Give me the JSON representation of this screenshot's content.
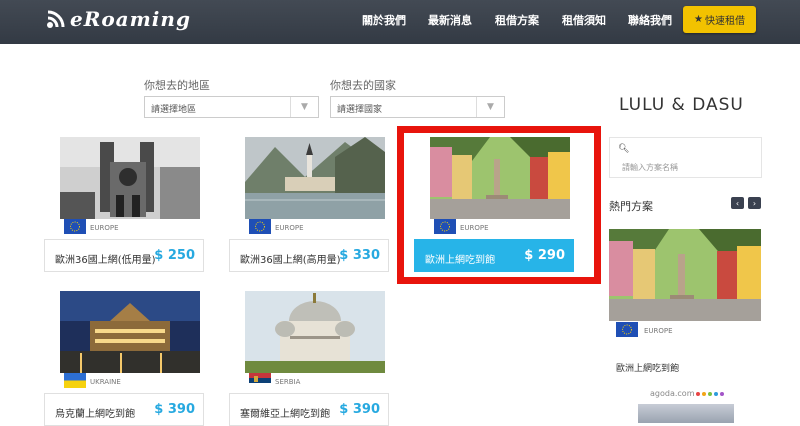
{
  "header": {
    "logo_text": "eRoaming",
    "nav": [
      "關於我們",
      "最新消息",
      "租借方案",
      "租借須知",
      "聯絡我們"
    ],
    "quick_rent": "快速租借"
  },
  "filters": {
    "region_label": "你想去的地區",
    "region_value": "請選擇地區",
    "country_label": "你想去的國家",
    "country_value": "請選擇國家"
  },
  "products": [
    {
      "name": "歐洲36國上網(低用量)",
      "price": "$ 250",
      "region": "EUROPE",
      "flag": "eu-flag-icon",
      "image": "notre-dame-photo"
    },
    {
      "name": "歐洲36國上網(高用量)",
      "price": "$ 330",
      "region": "EUROPE",
      "flag": "eu-flag-icon",
      "image": "hallstatt-lake-photo"
    },
    {
      "name": "歐洲上網吃到飽",
      "price": "$ 290",
      "region": "EUROPE",
      "flag": "eu-flag-icon",
      "image": "hallstatt-square-photo"
    },
    {
      "name": "烏克蘭上網吃到飽",
      "price": "$ 390",
      "region": "UKRAINE",
      "flag": "ukraine-flag-icon",
      "image": "lviv-opera-night-photo"
    },
    {
      "name": "塞爾維亞上網吃到飽",
      "price": "$ 390",
      "region": "SERBIA",
      "flag": "serbia-flag-icon",
      "image": "belgrade-temple-photo"
    }
  ],
  "sidebar": {
    "title": "LULU & DASU",
    "search_placeholder": "請輸入方案名稱",
    "hot_title": "熱門方案",
    "featured": {
      "region": "EUROPE",
      "name": "歐洲上網吃到飽"
    },
    "agoda_text": "agoda.com"
  },
  "colors": {
    "accent": "#27b4e8",
    "price": "#27a9e0",
    "header": "#3a414c",
    "quick_button": "#f2c200",
    "highlight": "#e8140c"
  }
}
